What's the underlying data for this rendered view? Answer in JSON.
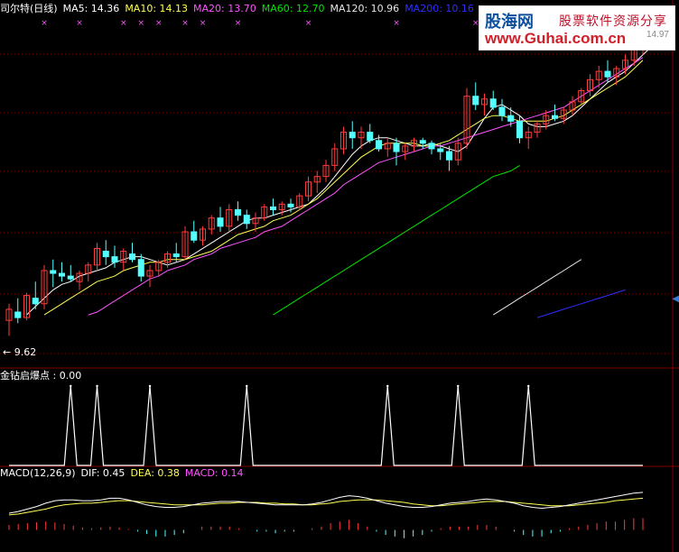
{
  "legend_main": {
    "title": "司尔特(日线)",
    "ma5": "MA5: 14.36",
    "ma10": "MA10: 14.13",
    "ma20": "MA20: 13.70",
    "ma60": "MA60: 12.70",
    "ma120": "MA120: 10.96",
    "ma200": "MA200: 10.16"
  },
  "legend_indicator": {
    "label": "金钻启爆点 : 0.00"
  },
  "legend_macd": {
    "name": "MACD(12,26,9)",
    "dif": "DIF: 0.45",
    "dea": "DEA: 0.38",
    "macd": "MACD: 0.14"
  },
  "price_low_label": "← 9.62",
  "watermark": {
    "cn1": "股海网",
    "cn2": "股票软件资源分享",
    "url": "www.Guhai.com.cn",
    "faded": "14.97"
  },
  "colors": {
    "up": "#ff3c3c",
    "down": "#54ffff",
    "ma5": "#ffffff",
    "ma10": "#ffff54",
    "ma20": "#ff54ff",
    "ma60": "#00e600",
    "ma120": "#e6e6e6",
    "ma200": "#2f2fff",
    "grid": "#800000",
    "signal": "#ffffff"
  },
  "chart_data": [
    {
      "type": "candlestick",
      "title": "司尔特(日线)",
      "y_range": [
        9.3,
        15.2
      ],
      "low_marker": 9.62,
      "candles": [
        {
          "o": 9.9,
          "h": 10.2,
          "l": 9.62,
          "c": 10.1
        },
        {
          "o": 10.05,
          "h": 10.3,
          "l": 9.85,
          "c": 9.95
        },
        {
          "o": 9.95,
          "h": 10.4,
          "l": 9.9,
          "c": 10.35
        },
        {
          "o": 10.3,
          "h": 10.6,
          "l": 10.1,
          "c": 10.2
        },
        {
          "o": 10.2,
          "h": 10.9,
          "l": 10.1,
          "c": 10.8
        },
        {
          "o": 10.8,
          "h": 11.0,
          "l": 10.5,
          "c": 10.75
        },
        {
          "o": 10.75,
          "h": 10.95,
          "l": 10.6,
          "c": 10.7
        },
        {
          "o": 10.7,
          "h": 10.9,
          "l": 10.6,
          "c": 10.65
        },
        {
          "o": 10.6,
          "h": 10.8,
          "l": 10.45,
          "c": 10.75
        },
        {
          "o": 10.75,
          "h": 10.95,
          "l": 10.6,
          "c": 10.9
        },
        {
          "o": 10.9,
          "h": 11.3,
          "l": 10.8,
          "c": 11.2
        },
        {
          "o": 11.15,
          "h": 11.35,
          "l": 10.9,
          "c": 11.05
        },
        {
          "o": 11.05,
          "h": 11.25,
          "l": 10.85,
          "c": 10.95
        },
        {
          "o": 10.95,
          "h": 11.2,
          "l": 10.8,
          "c": 11.15
        },
        {
          "o": 11.1,
          "h": 11.3,
          "l": 10.95,
          "c": 11.0
        },
        {
          "o": 11.0,
          "h": 11.1,
          "l": 10.6,
          "c": 10.7
        },
        {
          "o": 10.7,
          "h": 10.9,
          "l": 10.5,
          "c": 10.8
        },
        {
          "o": 10.8,
          "h": 11.0,
          "l": 10.7,
          "c": 10.95
        },
        {
          "o": 10.95,
          "h": 11.15,
          "l": 10.85,
          "c": 11.1
        },
        {
          "o": 11.1,
          "h": 11.3,
          "l": 10.95,
          "c": 11.05
        },
        {
          "o": 11.05,
          "h": 11.6,
          "l": 11.0,
          "c": 11.5
        },
        {
          "o": 11.5,
          "h": 11.7,
          "l": 11.3,
          "c": 11.35
        },
        {
          "o": 11.35,
          "h": 11.6,
          "l": 11.25,
          "c": 11.55
        },
        {
          "o": 11.55,
          "h": 11.8,
          "l": 11.45,
          "c": 11.75
        },
        {
          "o": 11.75,
          "h": 11.95,
          "l": 11.5,
          "c": 11.6
        },
        {
          "o": 11.6,
          "h": 12.0,
          "l": 11.5,
          "c": 11.9
        },
        {
          "o": 11.9,
          "h": 12.05,
          "l": 11.7,
          "c": 11.8
        },
        {
          "o": 11.8,
          "h": 11.9,
          "l": 11.55,
          "c": 11.65
        },
        {
          "o": 11.65,
          "h": 11.85,
          "l": 11.5,
          "c": 11.75
        },
        {
          "o": 11.75,
          "h": 12.0,
          "l": 11.7,
          "c": 11.95
        },
        {
          "o": 11.95,
          "h": 12.1,
          "l": 11.8,
          "c": 11.9
        },
        {
          "o": 11.9,
          "h": 12.05,
          "l": 11.8,
          "c": 12.0
        },
        {
          "o": 12.0,
          "h": 12.1,
          "l": 11.85,
          "c": 11.95
        },
        {
          "o": 11.95,
          "h": 12.2,
          "l": 11.9,
          "c": 12.15
        },
        {
          "o": 12.15,
          "h": 12.5,
          "l": 12.05,
          "c": 12.4
        },
        {
          "o": 12.4,
          "h": 12.6,
          "l": 12.2,
          "c": 12.5
        },
        {
          "o": 12.5,
          "h": 12.8,
          "l": 12.4,
          "c": 12.7
        },
        {
          "o": 12.7,
          "h": 13.1,
          "l": 12.6,
          "c": 13.0
        },
        {
          "o": 13.0,
          "h": 13.4,
          "l": 12.9,
          "c": 13.3
        },
        {
          "o": 13.3,
          "h": 13.5,
          "l": 13.0,
          "c": 13.2
        },
        {
          "o": 13.2,
          "h": 13.4,
          "l": 13.0,
          "c": 13.3
        },
        {
          "o": 13.3,
          "h": 13.45,
          "l": 13.1,
          "c": 13.15
        },
        {
          "o": 13.15,
          "h": 13.25,
          "l": 12.95,
          "c": 13.0
        },
        {
          "o": 13.0,
          "h": 13.2,
          "l": 12.85,
          "c": 13.1
        },
        {
          "o": 13.1,
          "h": 13.2,
          "l": 12.7,
          "c": 12.95
        },
        {
          "o": 12.95,
          "h": 13.1,
          "l": 12.8,
          "c": 13.05
        },
        {
          "o": 13.05,
          "h": 13.2,
          "l": 12.95,
          "c": 13.15
        },
        {
          "o": 13.15,
          "h": 13.2,
          "l": 13.0,
          "c": 13.1
        },
        {
          "o": 13.1,
          "h": 13.15,
          "l": 12.9,
          "c": 13.0
        },
        {
          "o": 13.0,
          "h": 13.1,
          "l": 12.8,
          "c": 12.95
        },
        {
          "o": 12.95,
          "h": 13.05,
          "l": 12.6,
          "c": 12.8
        },
        {
          "o": 12.8,
          "h": 13.2,
          "l": 12.7,
          "c": 13.1
        },
        {
          "o": 13.1,
          "h": 14.1,
          "l": 13.0,
          "c": 13.95
        },
        {
          "o": 13.95,
          "h": 14.2,
          "l": 13.7,
          "c": 13.8
        },
        {
          "o": 13.8,
          "h": 14.0,
          "l": 13.6,
          "c": 13.9
        },
        {
          "o": 13.9,
          "h": 14.05,
          "l": 13.7,
          "c": 13.75
        },
        {
          "o": 13.75,
          "h": 13.9,
          "l": 13.5,
          "c": 13.6
        },
        {
          "o": 13.6,
          "h": 13.75,
          "l": 13.4,
          "c": 13.5
        },
        {
          "o": 13.5,
          "h": 13.6,
          "l": 13.1,
          "c": 13.2
        },
        {
          "o": 13.2,
          "h": 13.4,
          "l": 13.0,
          "c": 13.3
        },
        {
          "o": 13.3,
          "h": 13.5,
          "l": 13.2,
          "c": 13.45
        },
        {
          "o": 13.45,
          "h": 13.7,
          "l": 13.35,
          "c": 13.6
        },
        {
          "o": 13.6,
          "h": 13.8,
          "l": 13.5,
          "c": 13.55
        },
        {
          "o": 13.55,
          "h": 13.75,
          "l": 13.45,
          "c": 13.7
        },
        {
          "o": 13.7,
          "h": 13.95,
          "l": 13.6,
          "c": 13.85
        },
        {
          "o": 13.85,
          "h": 14.1,
          "l": 13.8,
          "c": 14.05
        },
        {
          "o": 14.05,
          "h": 14.35,
          "l": 13.95,
          "c": 14.25
        },
        {
          "o": 14.25,
          "h": 14.5,
          "l": 14.1,
          "c": 14.4
        },
        {
          "o": 14.4,
          "h": 14.6,
          "l": 14.2,
          "c": 14.3
        },
        {
          "o": 14.3,
          "h": 14.5,
          "l": 14.15,
          "c": 14.45
        },
        {
          "o": 14.45,
          "h": 14.7,
          "l": 14.35,
          "c": 14.6
        },
        {
          "o": 14.6,
          "h": 14.95,
          "l": 14.5,
          "c": 14.85
        },
        {
          "o": 14.85,
          "h": 15.1,
          "l": 14.7,
          "c": 14.95
        }
      ],
      "ma_series": [
        {
          "name": "MA5",
          "start": 2,
          "values": [
            10.0,
            10.15,
            10.3,
            10.45,
            10.55,
            10.6,
            10.7,
            10.75,
            10.8,
            10.85,
            10.95,
            11.0,
            11.05,
            11.05,
            11.0,
            10.95,
            10.9,
            10.95,
            11.0,
            11.1,
            11.2,
            11.3,
            11.4,
            11.5,
            11.6,
            11.7,
            11.75,
            11.75,
            11.8,
            11.85,
            11.9,
            11.95,
            12.0,
            12.15,
            12.3,
            12.5,
            12.7,
            12.9,
            13.05,
            13.15,
            13.2,
            13.2,
            13.15,
            13.1,
            13.05,
            13.05,
            13.1,
            13.05,
            13.0,
            12.95,
            13.05,
            13.3,
            13.55,
            13.75,
            13.8,
            13.7,
            13.6,
            13.45,
            13.4,
            13.4,
            13.45,
            13.5,
            13.6,
            13.75,
            13.9,
            14.05,
            14.2,
            14.3,
            14.4,
            14.55,
            14.7,
            14.85
          ]
        },
        {
          "name": "MA10",
          "start": 4,
          "values": [
            10.0,
            10.1,
            10.2,
            10.3,
            10.4,
            10.5,
            10.6,
            10.65,
            10.7,
            10.8,
            10.85,
            10.9,
            10.95,
            10.95,
            11.0,
            11.0,
            11.0,
            11.05,
            11.1,
            11.15,
            11.25,
            11.35,
            11.45,
            11.5,
            11.55,
            11.6,
            11.7,
            11.75,
            11.8,
            11.9,
            12.0,
            12.1,
            12.25,
            12.4,
            12.55,
            12.7,
            12.85,
            12.95,
            13.05,
            13.1,
            13.1,
            13.1,
            13.1,
            13.05,
            13.05,
            13.1,
            13.15,
            13.25,
            13.35,
            13.45,
            13.55,
            13.6,
            13.6,
            13.55,
            13.5,
            13.5,
            13.5,
            13.5,
            13.55,
            13.6,
            13.7,
            13.8,
            13.9,
            14.0,
            14.1,
            14.2,
            14.3,
            14.45,
            14.6
          ]
        },
        {
          "name": "MA20",
          "start": 9,
          "values": [
            10.0,
            10.05,
            10.15,
            10.25,
            10.35,
            10.45,
            10.55,
            10.65,
            10.7,
            10.8,
            10.85,
            10.9,
            11.0,
            11.05,
            11.1,
            11.2,
            11.25,
            11.3,
            11.35,
            11.4,
            11.5,
            11.55,
            11.6,
            11.7,
            11.8,
            11.9,
            12.0,
            12.1,
            12.2,
            12.35,
            12.45,
            12.55,
            12.65,
            12.75,
            12.8,
            12.85,
            12.9,
            12.95,
            13.0,
            13.05,
            13.05,
            13.1,
            13.15,
            13.2,
            13.25,
            13.3,
            13.35,
            13.4,
            13.45,
            13.5,
            13.55,
            13.6,
            13.65,
            13.7,
            13.75,
            13.85,
            13.95,
            14.05,
            14.15,
            14.25,
            14.35,
            14.45,
            14.55,
            14.65
          ]
        },
        {
          "name": "MA60",
          "start": 30,
          "values": [
            10.0,
            10.1,
            10.2,
            10.3,
            10.4,
            10.5,
            10.6,
            10.7,
            10.8,
            10.9,
            11.0,
            11.1,
            11.2,
            11.3,
            11.4,
            11.5,
            11.6,
            11.7,
            11.8,
            11.9,
            12.0,
            12.1,
            12.2,
            12.3,
            12.4,
            12.5,
            12.55,
            12.6,
            12.7
          ]
        },
        {
          "name": "MA120",
          "start": 55,
          "values": [
            10.0,
            10.1,
            10.2,
            10.3,
            10.4,
            10.5,
            10.6,
            10.7,
            10.8,
            10.9,
            11.0
          ]
        },
        {
          "name": "MA200",
          "start": 60,
          "values": [
            9.95,
            10.0,
            10.05,
            10.1,
            10.15,
            10.2,
            10.25,
            10.3,
            10.35,
            10.4,
            10.45
          ]
        }
      ]
    },
    {
      "type": "line",
      "title": "金钻启爆点",
      "value_range": [
        0,
        1
      ],
      "signal_bars": [
        7,
        10,
        16,
        27,
        43,
        51,
        59
      ],
      "signals": [
        1,
        1,
        1,
        1,
        1,
        1,
        1
      ]
    },
    {
      "type": "macd",
      "title": "MACD(12,26,9)",
      "dif": [
        0.2,
        0.22,
        0.25,
        0.28,
        0.32,
        0.35,
        0.36,
        0.36,
        0.35,
        0.35,
        0.36,
        0.38,
        0.38,
        0.36,
        0.33,
        0.3,
        0.28,
        0.27,
        0.27,
        0.28,
        0.3,
        0.32,
        0.33,
        0.34,
        0.34,
        0.34,
        0.33,
        0.32,
        0.31,
        0.3,
        0.3,
        0.3,
        0.3,
        0.31,
        0.33,
        0.36,
        0.39,
        0.41,
        0.4,
        0.38,
        0.35,
        0.32,
        0.3,
        0.28,
        0.27,
        0.27,
        0.28,
        0.3,
        0.32,
        0.33,
        0.34,
        0.36,
        0.37,
        0.36,
        0.34,
        0.32,
        0.29,
        0.27,
        0.26,
        0.27,
        0.28,
        0.3,
        0.32,
        0.34,
        0.36,
        0.38,
        0.4,
        0.42,
        0.44,
        0.45
      ],
      "dea": [
        0.18,
        0.19,
        0.21,
        0.23,
        0.25,
        0.28,
        0.3,
        0.31,
        0.32,
        0.32,
        0.33,
        0.34,
        0.35,
        0.35,
        0.34,
        0.33,
        0.32,
        0.31,
        0.3,
        0.3,
        0.3,
        0.3,
        0.31,
        0.32,
        0.32,
        0.33,
        0.33,
        0.33,
        0.32,
        0.32,
        0.31,
        0.31,
        0.3,
        0.3,
        0.31,
        0.32,
        0.34,
        0.35,
        0.36,
        0.36,
        0.36,
        0.35,
        0.34,
        0.33,
        0.31,
        0.3,
        0.29,
        0.29,
        0.3,
        0.31,
        0.32,
        0.33,
        0.34,
        0.34,
        0.34,
        0.33,
        0.32,
        0.31,
        0.3,
        0.29,
        0.29,
        0.29,
        0.3,
        0.31,
        0.32,
        0.33,
        0.35,
        0.36,
        0.37,
        0.38
      ],
      "hist": [
        0.06,
        0.07,
        0.08,
        0.09,
        0.1,
        0.09,
        0.07,
        0.05,
        0.03,
        0.02,
        0.03,
        0.04,
        0.03,
        0.01,
        -0.02,
        -0.05,
        -0.08,
        -0.08,
        -0.06,
        -0.04,
        0.0,
        0.04,
        0.04,
        0.04,
        0.04,
        0.02,
        0.0,
        -0.02,
        -0.02,
        -0.04,
        -0.02,
        -0.02,
        0.0,
        0.02,
        0.04,
        0.08,
        0.1,
        0.12,
        0.08,
        0.04,
        -0.02,
        -0.06,
        -0.08,
        -0.1,
        -0.08,
        -0.06,
        -0.02,
        0.02,
        0.04,
        0.04,
        0.04,
        0.06,
        0.06,
        0.04,
        0.0,
        -0.02,
        -0.06,
        -0.08,
        -0.08,
        -0.04,
        -0.02,
        0.02,
        0.04,
        0.06,
        0.08,
        0.1,
        0.1,
        0.12,
        0.14,
        0.14
      ],
      "y_range": [
        -0.2,
        0.6
      ]
    }
  ]
}
